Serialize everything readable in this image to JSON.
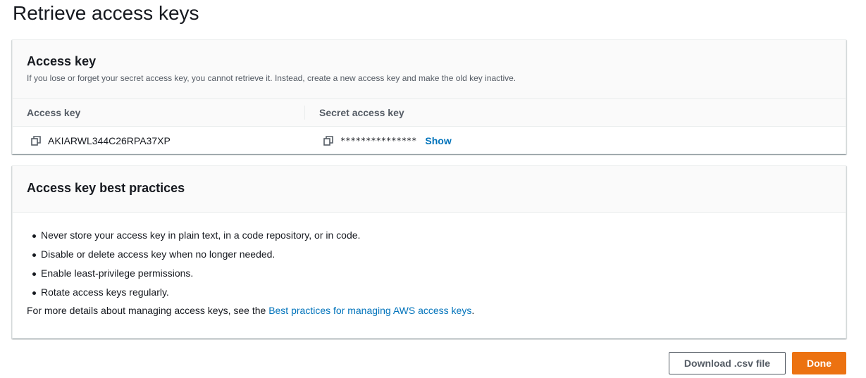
{
  "page": {
    "title": "Retrieve access keys"
  },
  "access_key_panel": {
    "title": "Access key",
    "description": "If you lose or forget your secret access key, you cannot retrieve it. Instead, create a new access key and make the old key inactive.",
    "columns": [
      "Access key",
      "Secret access key"
    ],
    "row": {
      "access_key": "AKIARWL344C26RPA37XP",
      "secret_masked": "***************",
      "show_label": "Show"
    }
  },
  "best_practices_panel": {
    "title": "Access key best practices",
    "items": [
      "Never store your access key in plain text, in a code repository, or in code.",
      "Disable or delete access key when no longer needed.",
      "Enable least-privilege permissions.",
      "Rotate access keys regularly."
    ],
    "more_prefix": "For more details about managing access keys, see the ",
    "more_link": "Best practices for managing AWS access keys",
    "more_suffix": "."
  },
  "footer": {
    "download_label": "Download .csv file",
    "done_label": "Done"
  },
  "icons": {
    "copy": "copy-icon"
  },
  "colors": {
    "primary": "#ec7211",
    "link": "#0073bb"
  }
}
